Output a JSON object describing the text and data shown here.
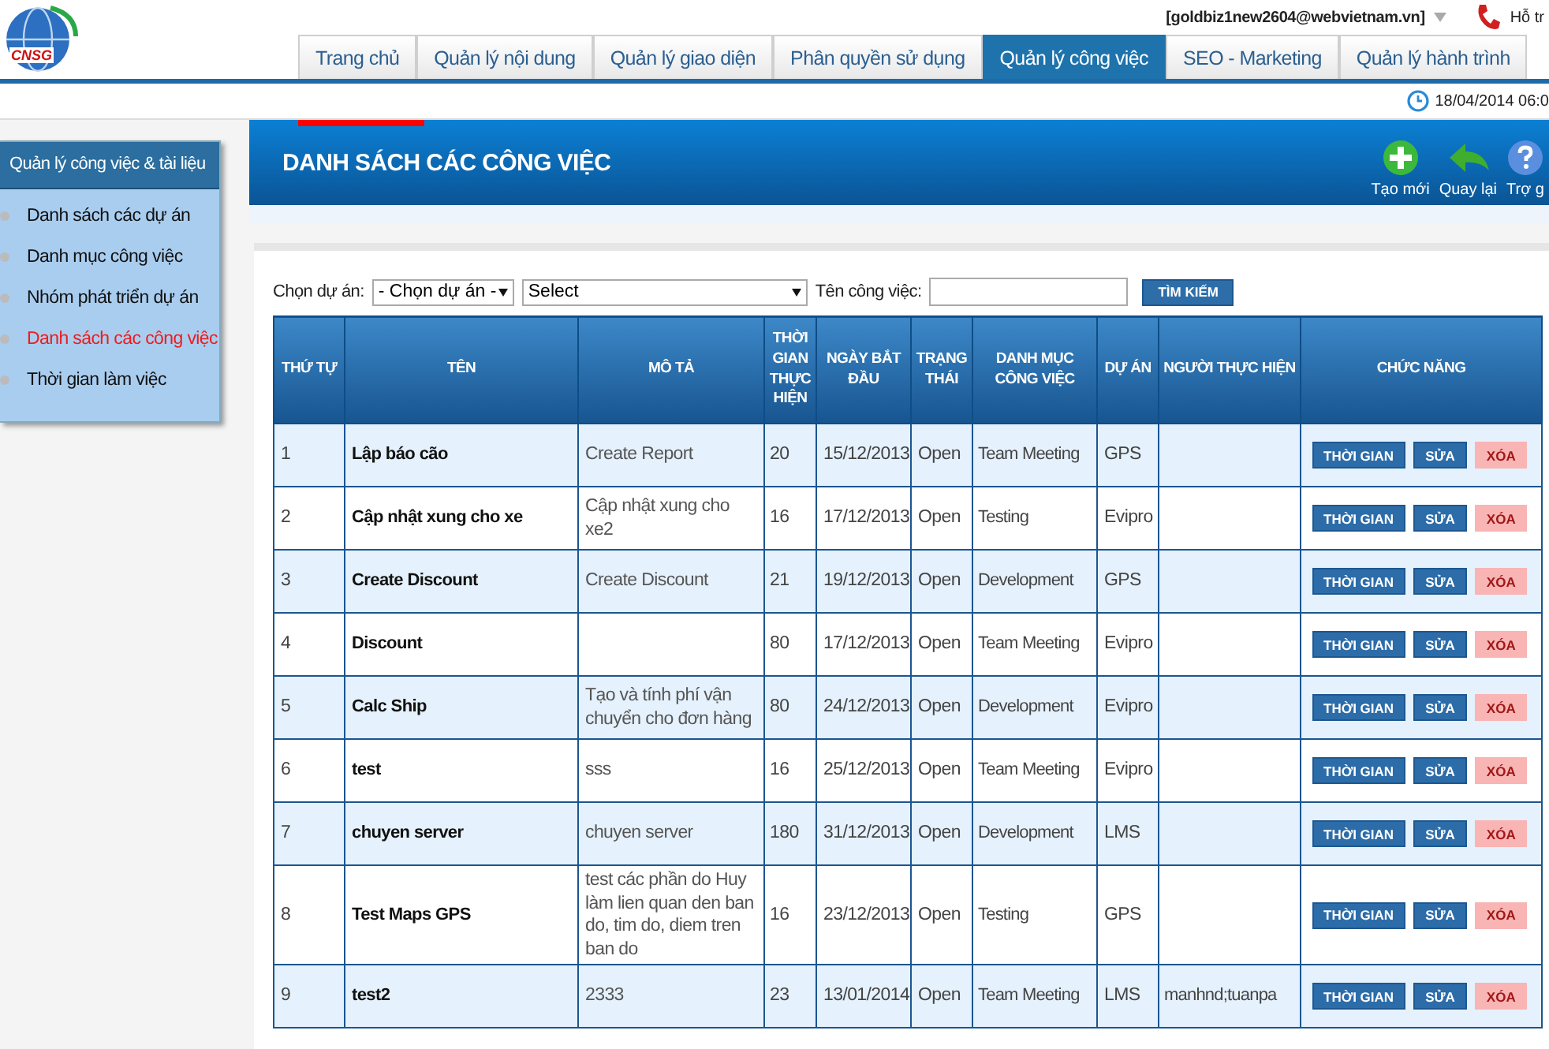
{
  "header": {
    "logo_text": "CNSG",
    "user": "[goldbiz1new2604@webvietnam.vn]",
    "support": "Hỗ tr"
  },
  "tabs": [
    {
      "label": "Trang chủ",
      "selected": false
    },
    {
      "label": "Quản lý nội dung",
      "selected": false
    },
    {
      "label": "Quản lý giao diện",
      "selected": false
    },
    {
      "label": "Phân quyền sử dụng",
      "selected": false
    },
    {
      "label": "Quản lý công việc",
      "selected": true
    },
    {
      "label": "SEO - Marketing",
      "selected": false
    },
    {
      "label": "Quản lý hành trình",
      "selected": false
    }
  ],
  "datetime": "18/04/2014 06:0",
  "sidebar": {
    "title": "Quản lý công việc & tài liệu",
    "items": [
      {
        "label": "Danh sách các dự án",
        "selected": false
      },
      {
        "label": "Danh mục công việc",
        "selected": false
      },
      {
        "label": "Nhóm phát triển dự án",
        "selected": false
      },
      {
        "label": "Danh sách các công việc",
        "selected": true
      },
      {
        "label": "Thời gian làm việc",
        "selected": false
      }
    ]
  },
  "page_title": "DANH SÁCH CÁC CÔNG VIỆC",
  "toolbar": [
    {
      "label": "Tạo mới",
      "kind": "add"
    },
    {
      "label": "Quay lại",
      "kind": "back"
    },
    {
      "label": "Trợ g",
      "kind": "help"
    }
  ],
  "filters": {
    "project_label": "Chọn dự án:",
    "project_value": "- Chọn dự án -",
    "select_value": "Select",
    "name_label": "Tên công việc:",
    "search_button": "TÌM KIẾM"
  },
  "table": {
    "columns": [
      "THỨ TỰ",
      "TÊN",
      "MÔ TẢ",
      "THỜI GIAN THỰC HIỆN",
      "NGÀY BẮT ĐẦU",
      "TRẠNG THÁI",
      "DANH MỤC CÔNG VIỆC",
      "DỰ ÁN",
      "NGƯỜI THỰC HIỆN",
      "CHỨC NĂNG"
    ],
    "rows": [
      {
        "cells": [
          "1",
          "Lập báo cão",
          "Create Report",
          "20",
          "15/12/2013",
          "Open",
          "Team Meeting",
          "GPS",
          ""
        ],
        "actions": [
          {
            "label": "THỜI GIAN",
            "kind": "time",
            "disabled": false
          },
          {
            "label": "SỬA",
            "kind": "edit",
            "disabled": false
          },
          {
            "label": "XÓA",
            "kind": "delete",
            "disabled": true
          }
        ]
      },
      {
        "cells": [
          "2",
          "Cập nhật xung cho xe",
          "Cập nhật xung cho xe2",
          "16",
          "17/12/2013",
          "Open",
          "Testing",
          "Evipro",
          ""
        ],
        "actions": [
          {
            "label": "THỜI GIAN",
            "kind": "time",
            "disabled": false
          },
          {
            "label": "SỬA",
            "kind": "edit",
            "disabled": false
          },
          {
            "label": "XÓA",
            "kind": "delete",
            "disabled": true
          }
        ]
      },
      {
        "cells": [
          "3",
          "Create Discount",
          "Create Discount",
          "21",
          "19/12/2013",
          "Open",
          "Development",
          "GPS",
          ""
        ],
        "actions": [
          {
            "label": "THỜI GIAN",
            "kind": "time",
            "disabled": false
          },
          {
            "label": "SỬA",
            "kind": "edit",
            "disabled": false
          },
          {
            "label": "XÓA",
            "kind": "delete",
            "disabled": true
          }
        ]
      },
      {
        "cells": [
          "4",
          "Discount",
          "",
          "80",
          "17/12/2013",
          "Open",
          "Team Meeting",
          "Evipro",
          ""
        ],
        "actions": [
          {
            "label": "THỜI GIAN",
            "kind": "time",
            "disabled": false
          },
          {
            "label": "SỬA",
            "kind": "edit",
            "disabled": false
          },
          {
            "label": "XÓA",
            "kind": "delete",
            "disabled": true
          }
        ]
      },
      {
        "cells": [
          "5",
          "Calc Ship",
          "Tạo và tính phí vận chuyển cho đơn hàng",
          "80",
          "24/12/2013",
          "Open",
          "Development",
          "Evipro",
          ""
        ],
        "actions": [
          {
            "label": "THỜI GIAN",
            "kind": "time",
            "disabled": false
          },
          {
            "label": "SỬA",
            "kind": "edit",
            "disabled": false
          },
          {
            "label": "XÓA",
            "kind": "delete",
            "disabled": true
          }
        ]
      },
      {
        "cells": [
          "6",
          "test",
          "sss",
          "16",
          "25/12/2013",
          "Open",
          "Team Meeting",
          "Evipro",
          ""
        ],
        "actions": [
          {
            "label": "THỜI GIAN",
            "kind": "time",
            "disabled": false
          },
          {
            "label": "SỬA",
            "kind": "edit",
            "disabled": false
          },
          {
            "label": "XÓA",
            "kind": "delete",
            "disabled": true
          }
        ]
      },
      {
        "cells": [
          "7",
          "chuyen server",
          "chuyen server",
          "180",
          "31/12/2013",
          "Open",
          "Development",
          "LMS",
          ""
        ],
        "actions": [
          {
            "label": "THỜI GIAN",
            "kind": "time",
            "disabled": false
          },
          {
            "label": "SỬA",
            "kind": "edit",
            "disabled": false
          },
          {
            "label": "XÓA",
            "kind": "delete",
            "disabled": true
          }
        ]
      },
      {
        "cells": [
          "8",
          "Test Maps GPS",
          "test các phần do Huy làm lien quan den ban do, tim do, diem tren ban do",
          "16",
          "23/12/2013",
          "Open",
          "Testing",
          "GPS",
          ""
        ],
        "actions": [
          {
            "label": "THỜI GIAN",
            "kind": "time",
            "disabled": false
          },
          {
            "label": "SỬA",
            "kind": "edit",
            "disabled": false
          },
          {
            "label": "XÓA",
            "kind": "delete",
            "disabled": true
          }
        ]
      },
      {
        "cells": [
          "9",
          "test2",
          "2333",
          "23",
          "13/01/2014",
          "Open",
          "Team Meeting",
          "LMS",
          "manhnd;tuanpa"
        ],
        "actions": [
          {
            "label": "THỜI GIAN",
            "kind": "time",
            "disabled": false
          },
          {
            "label": "SỬA",
            "kind": "edit",
            "disabled": false
          },
          {
            "label": "XÓA",
            "kind": "delete",
            "disabled": true
          }
        ]
      }
    ]
  }
}
